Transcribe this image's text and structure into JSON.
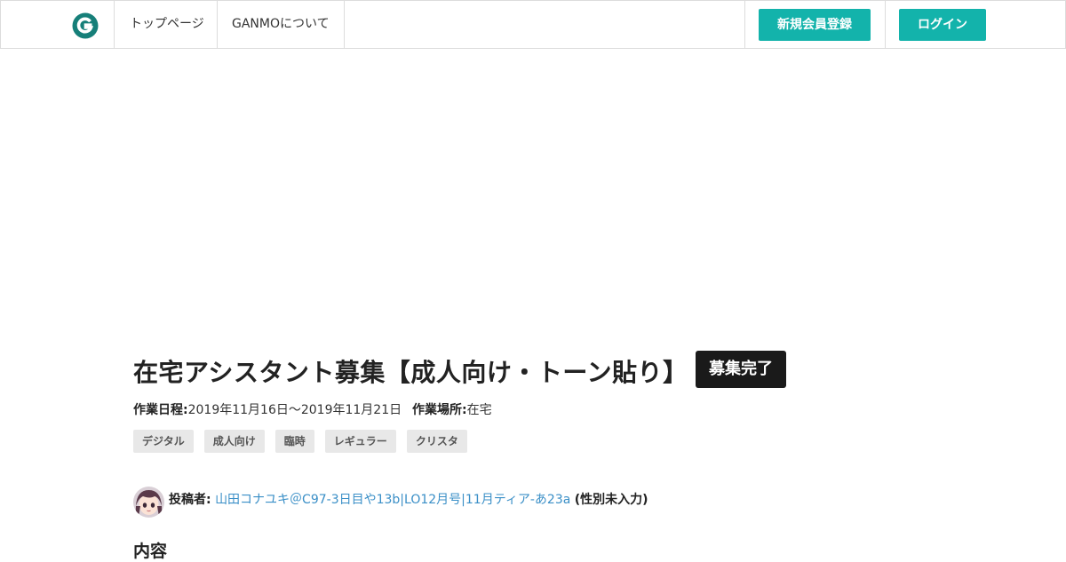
{
  "header": {
    "logo_letter": "G",
    "nav": [
      {
        "label": "トップページ"
      },
      {
        "label": "GANMOについて"
      }
    ],
    "register_label": "新規会員登録",
    "login_label": "ログイン",
    "accent_color": "#13b3ab"
  },
  "post": {
    "title": "在宅アシスタント募集【成人向け・トーン貼り】",
    "status": "募集完了",
    "schedule_label": "作業日程:",
    "schedule_value": "2019年11月16日〜2019年11月21日",
    "location_label": "作業場所:",
    "location_value": "在宅",
    "tags": [
      "デジタル",
      "成人向け",
      "臨時",
      "レギュラー",
      "クリスタ"
    ],
    "poster_label": "投稿者:",
    "poster_name": "山田コナユキ＠C97-3日目や13b|LO12月号|11月ティア-あ23a",
    "poster_gender": "(性別未入力)",
    "content_heading": "内容"
  },
  "colors": {
    "link": "#3a8fc7",
    "tag_bg": "#e8e8e8",
    "badge_bg": "#1a1a1a"
  }
}
